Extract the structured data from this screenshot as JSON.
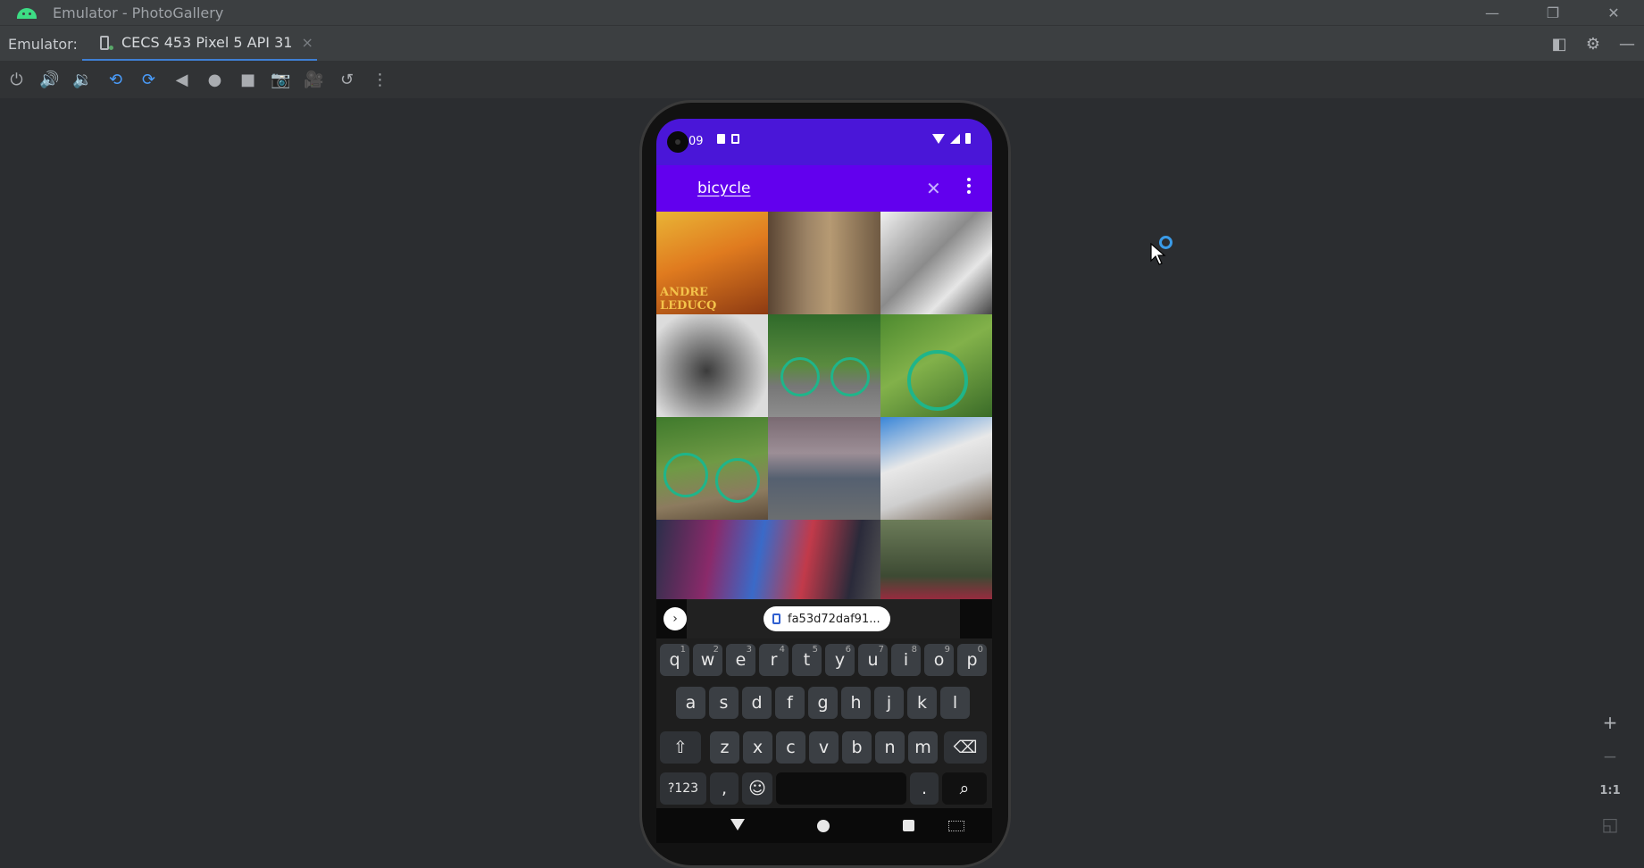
{
  "window": {
    "title": "Emulator - PhotoGallery",
    "controls": [
      "minimize-icon",
      "restore-icon",
      "close-icon"
    ]
  },
  "tabbar": {
    "prefix": "Emulator:",
    "tab_label": "CECS 453 Pixel 5 API 31",
    "tab_close": "×",
    "right_icons": [
      "layout-icon",
      "gear-icon",
      "minimize-panel-icon"
    ]
  },
  "toolbar": {
    "icons": [
      "power-icon",
      "volume-up-icon",
      "volume-down-icon",
      "rotate-left-icon",
      "rotate-right-icon",
      "back-icon",
      "home-icon",
      "overview-icon",
      "screenshot-icon",
      "record-icon",
      "snapshot-icon",
      "more-icon"
    ]
  },
  "phone": {
    "status": {
      "time": "09"
    },
    "appbar": {
      "query": "bicycle",
      "clear_symbol": "✕"
    },
    "photo_logo_text": "ANDRE LEDUCQ",
    "clipboard": {
      "expand": "›",
      "chip": "fa53d72daf91..."
    },
    "keyboard": {
      "row1": [
        {
          "k": "q",
          "h": "1"
        },
        {
          "k": "w",
          "h": "2"
        },
        {
          "k": "e",
          "h": "3"
        },
        {
          "k": "r",
          "h": "4"
        },
        {
          "k": "t",
          "h": "5"
        },
        {
          "k": "y",
          "h": "6"
        },
        {
          "k": "u",
          "h": "7"
        },
        {
          "k": "i",
          "h": "8"
        },
        {
          "k": "o",
          "h": "9"
        },
        {
          "k": "p",
          "h": "0"
        }
      ],
      "row2": [
        "a",
        "s",
        "d",
        "f",
        "g",
        "h",
        "j",
        "k",
        "l"
      ],
      "row3": [
        "z",
        "x",
        "c",
        "v",
        "b",
        "n",
        "m"
      ],
      "shift": "⇧",
      "backspace": "⌫",
      "symbols": "?123",
      "comma": ",",
      "emoji": "☺",
      "period": ".",
      "search": "⌕"
    }
  },
  "zoom": {
    "plus": "+",
    "minus": "−",
    "one_to_one": "1:1"
  },
  "colors": {
    "status_bar": "#4a16d8",
    "app_bar": "#6200ee",
    "tab_accent": "#3f7fd4"
  }
}
